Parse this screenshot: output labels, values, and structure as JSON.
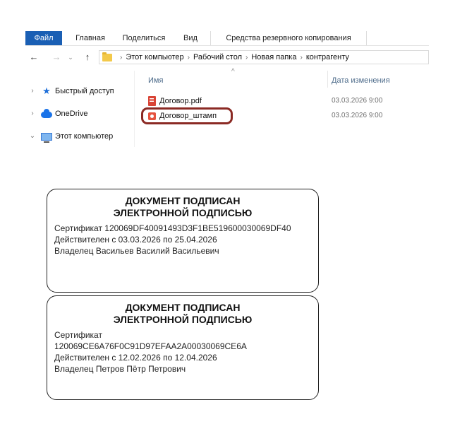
{
  "ribbon": {
    "tabs": [
      "Файл",
      "Главная",
      "Поделиться",
      "Вид",
      "Средства резервного копирования"
    ]
  },
  "address": {
    "crumbs": [
      "Этот компьютер",
      "Рабочий стол",
      "Новая папка",
      "контрагенту"
    ]
  },
  "nav": {
    "items": [
      {
        "label": "Быстрый доступ",
        "icon": "star-icon",
        "expanded": false
      },
      {
        "label": "OneDrive",
        "icon": "cloud-icon",
        "expanded": false
      },
      {
        "label": "Этот компьютер",
        "icon": "computer-icon",
        "expanded": true
      }
    ]
  },
  "list": {
    "col_name": "Имя",
    "col_date": "Дата изменения",
    "files": [
      {
        "name": "Договор.pdf",
        "date": "03.03.2026 9:00",
        "icon": "pdf-file-icon"
      },
      {
        "name": "Договор_штамп",
        "date": "03.03.2026 9:00",
        "icon": "stamp-file-icon"
      }
    ]
  },
  "stamps": [
    {
      "title_line1": "ДОКУМЕНТ ПОДПИСАН",
      "title_line2": "ЭЛЕКТРОННОЙ ПОДПИСЬЮ",
      "cert_label": "Сертификат 120069DF40091493D3F1BE519600030069DF40",
      "valid": "Действителен с 03.03.2026 по 25.04.2026",
      "owner": "Владелец Васильев Василий Васильевич"
    },
    {
      "title_line1": "ДОКУМЕНТ ПОДПИСАН",
      "title_line2": "ЭЛЕКТРОННОЙ ПОДПИСЬЮ",
      "cert_label": "Сертификат",
      "cert_number": "120069CE6A76F0C91D97EFAA2A00030069CE6A",
      "valid": "Действителен с 12.02.2026 по 12.04.2026",
      "owner": "Владелец Петров Пётр Петрович"
    }
  ],
  "colors": {
    "accent": "#1a5fb4",
    "highlight_border": "#8b2a24",
    "column_header": "#4d6b8a"
  }
}
